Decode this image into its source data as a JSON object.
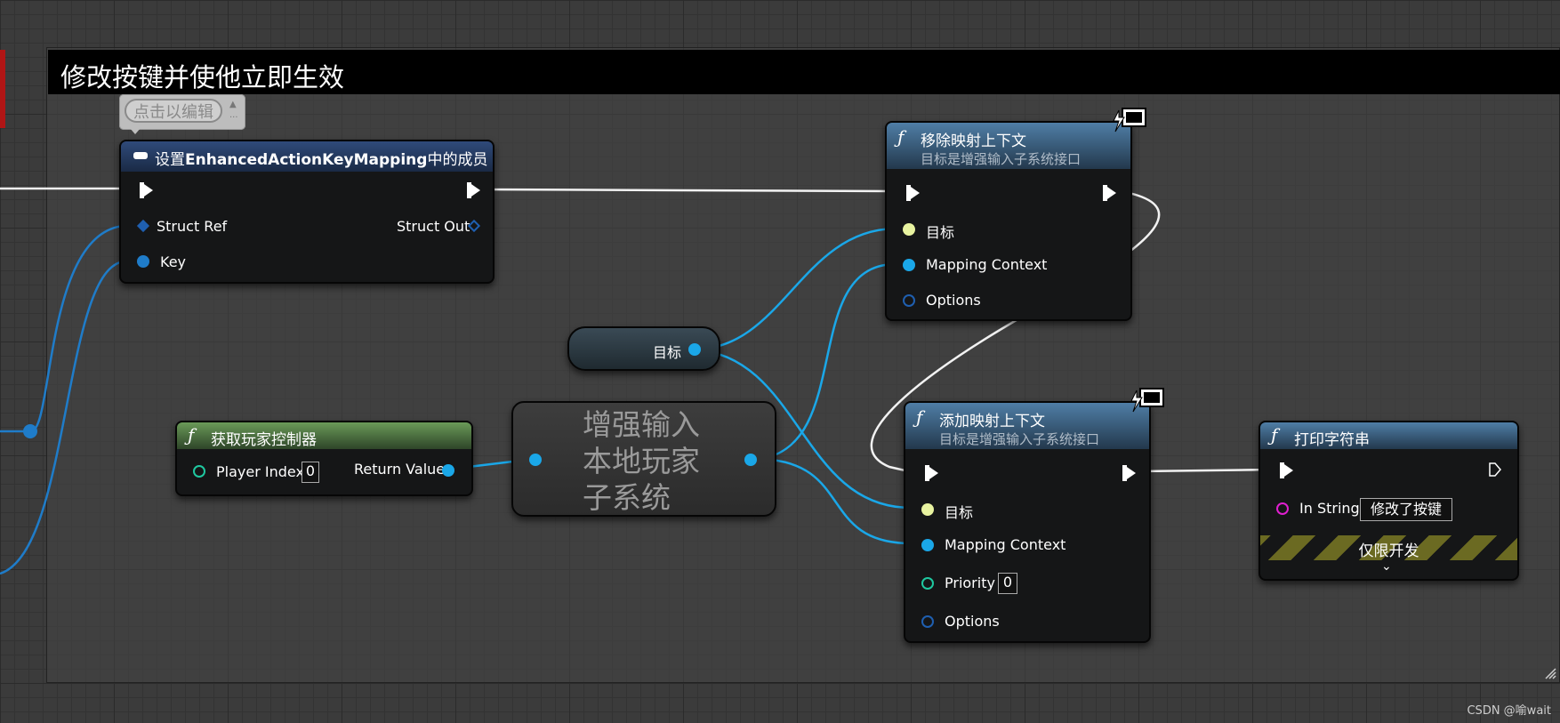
{
  "comment": {
    "title": "修改按键并使他立即生效"
  },
  "bubble": {
    "label": "点击以编辑"
  },
  "set_node": {
    "title_prefix": "设置",
    "title_bold": "EnhancedActionKeyMapping",
    "title_suffix": "中的成员",
    "pins": {
      "struct_ref": "Struct Ref",
      "key": "Key",
      "struct_out": "Struct Out"
    }
  },
  "remove_node": {
    "title": "移除映射上下文",
    "subtitle": "目标是增强输入子系统接口",
    "pins": {
      "target": "目标",
      "mapping_context": "Mapping Context",
      "options": "Options"
    }
  },
  "target_node": {
    "label": "目标"
  },
  "get_player_node": {
    "title": "获取玩家控制器",
    "pins": {
      "player_index": "Player Index",
      "player_index_value": "0",
      "return_value": "Return Value"
    }
  },
  "subsystem_node": {
    "line1": "增强输入",
    "line2": "本地玩家",
    "line3": "子系统"
  },
  "add_node": {
    "title": "添加映射上下文",
    "subtitle": "目标是增强输入子系统接口",
    "pins": {
      "target": "目标",
      "mapping_context": "Mapping Context",
      "priority": "Priority",
      "priority_value": "0",
      "options": "Options"
    }
  },
  "print_node": {
    "title": "打印字符串",
    "pins": {
      "in_string": "In String",
      "in_string_value": "修改了按键"
    },
    "dev_only": "仅限开发"
  },
  "watermark": "CSDN @喻wait",
  "colors": {
    "exec": "#ffffff",
    "object_pin": "#1aa7e8",
    "struct_pin": "#1f5fb0",
    "int_pin": "#1fc8a0",
    "string_pin": "#e01fd0",
    "target_pin": "#e8f3a0",
    "func_header": "#3f6f96",
    "pure_header": "#5e8a4f"
  },
  "icons": [
    "function-icon",
    "server-client-icon",
    "exec-pin-icon",
    "chevron-down-icon"
  ]
}
